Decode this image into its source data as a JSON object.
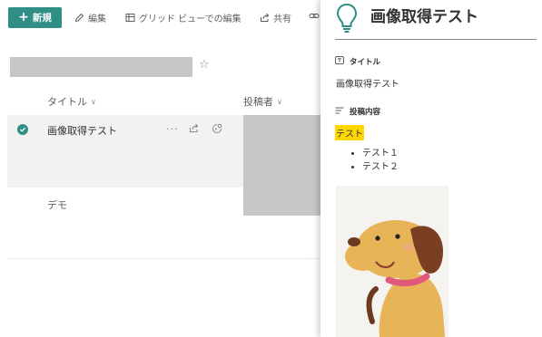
{
  "toolbar": {
    "new_label": "新規",
    "edit_label": "編集",
    "grid_edit_label": "グリッド ビューでの編集",
    "share_label": "共有"
  },
  "list": {
    "columns": {
      "title": "タイトル",
      "poster": "投稿者"
    },
    "rows": [
      {
        "title": "画像取得テスト"
      },
      {
        "title": "デモ"
      }
    ]
  },
  "detail": {
    "title": "画像取得テスト",
    "title_field_label": "タイトル",
    "title_field_value": "画像取得テスト",
    "body_field_label": "投稿内容",
    "highlighted_text": "テスト",
    "bullets": [
      "テスト１",
      "テスト２"
    ],
    "image_name": "dog-illustration"
  },
  "colors": {
    "accent": "#2f8f86",
    "highlight": "#ffd700",
    "placeholder_gray": "#c6c6c6",
    "selected_row": "#f3f2f1"
  }
}
